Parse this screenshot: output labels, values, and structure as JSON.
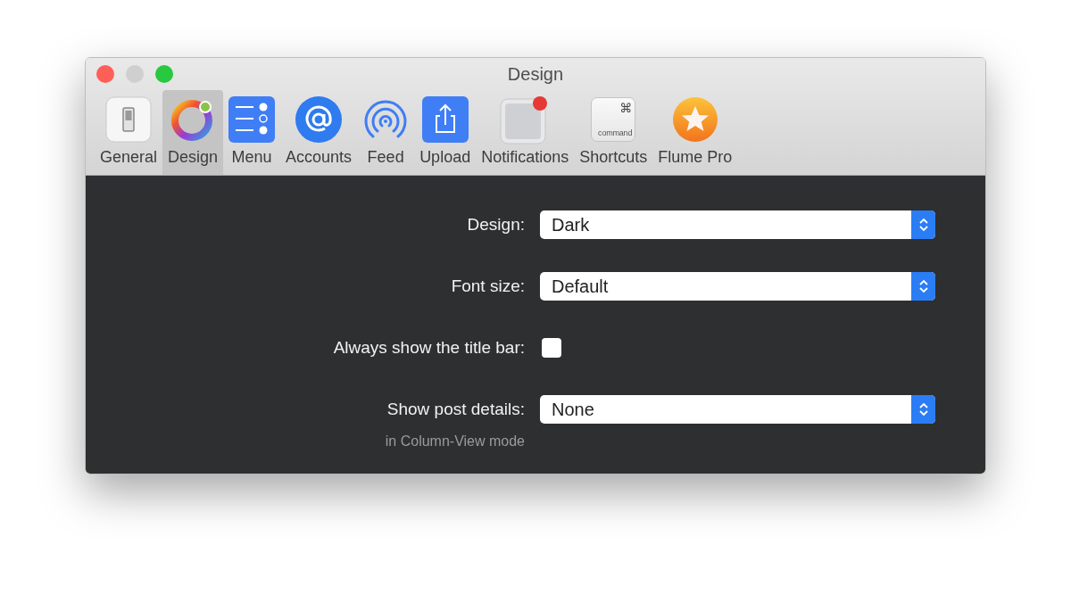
{
  "window": {
    "title": "Design"
  },
  "tabs": [
    {
      "kind": "switch",
      "label": "General",
      "selected": false
    },
    {
      "kind": "colorwheel",
      "label": "Design",
      "selected": true
    },
    {
      "kind": "checklist",
      "label": "Menu",
      "selected": false
    },
    {
      "kind": "at",
      "label": "Accounts",
      "selected": false
    },
    {
      "kind": "broadcast",
      "label": "Feed",
      "selected": false
    },
    {
      "kind": "share",
      "label": "Upload",
      "selected": false
    },
    {
      "kind": "badge",
      "label": "Notifications",
      "selected": false
    },
    {
      "kind": "key",
      "label": "Shortcuts",
      "selected": false,
      "key_symbol": "⌘",
      "key_label": "command"
    },
    {
      "kind": "star",
      "label": "Flume Pro",
      "selected": false
    }
  ],
  "settings": [
    {
      "kind": "select",
      "label": "Design:",
      "value": "Dark"
    },
    {
      "kind": "select",
      "label": "Font size:",
      "value": "Default"
    },
    {
      "kind": "checkbox",
      "label": "Always show the title bar:",
      "checked": false
    },
    {
      "kind": "select",
      "label": "Show post details:",
      "note": "in Column-View mode",
      "value": "None"
    }
  ]
}
